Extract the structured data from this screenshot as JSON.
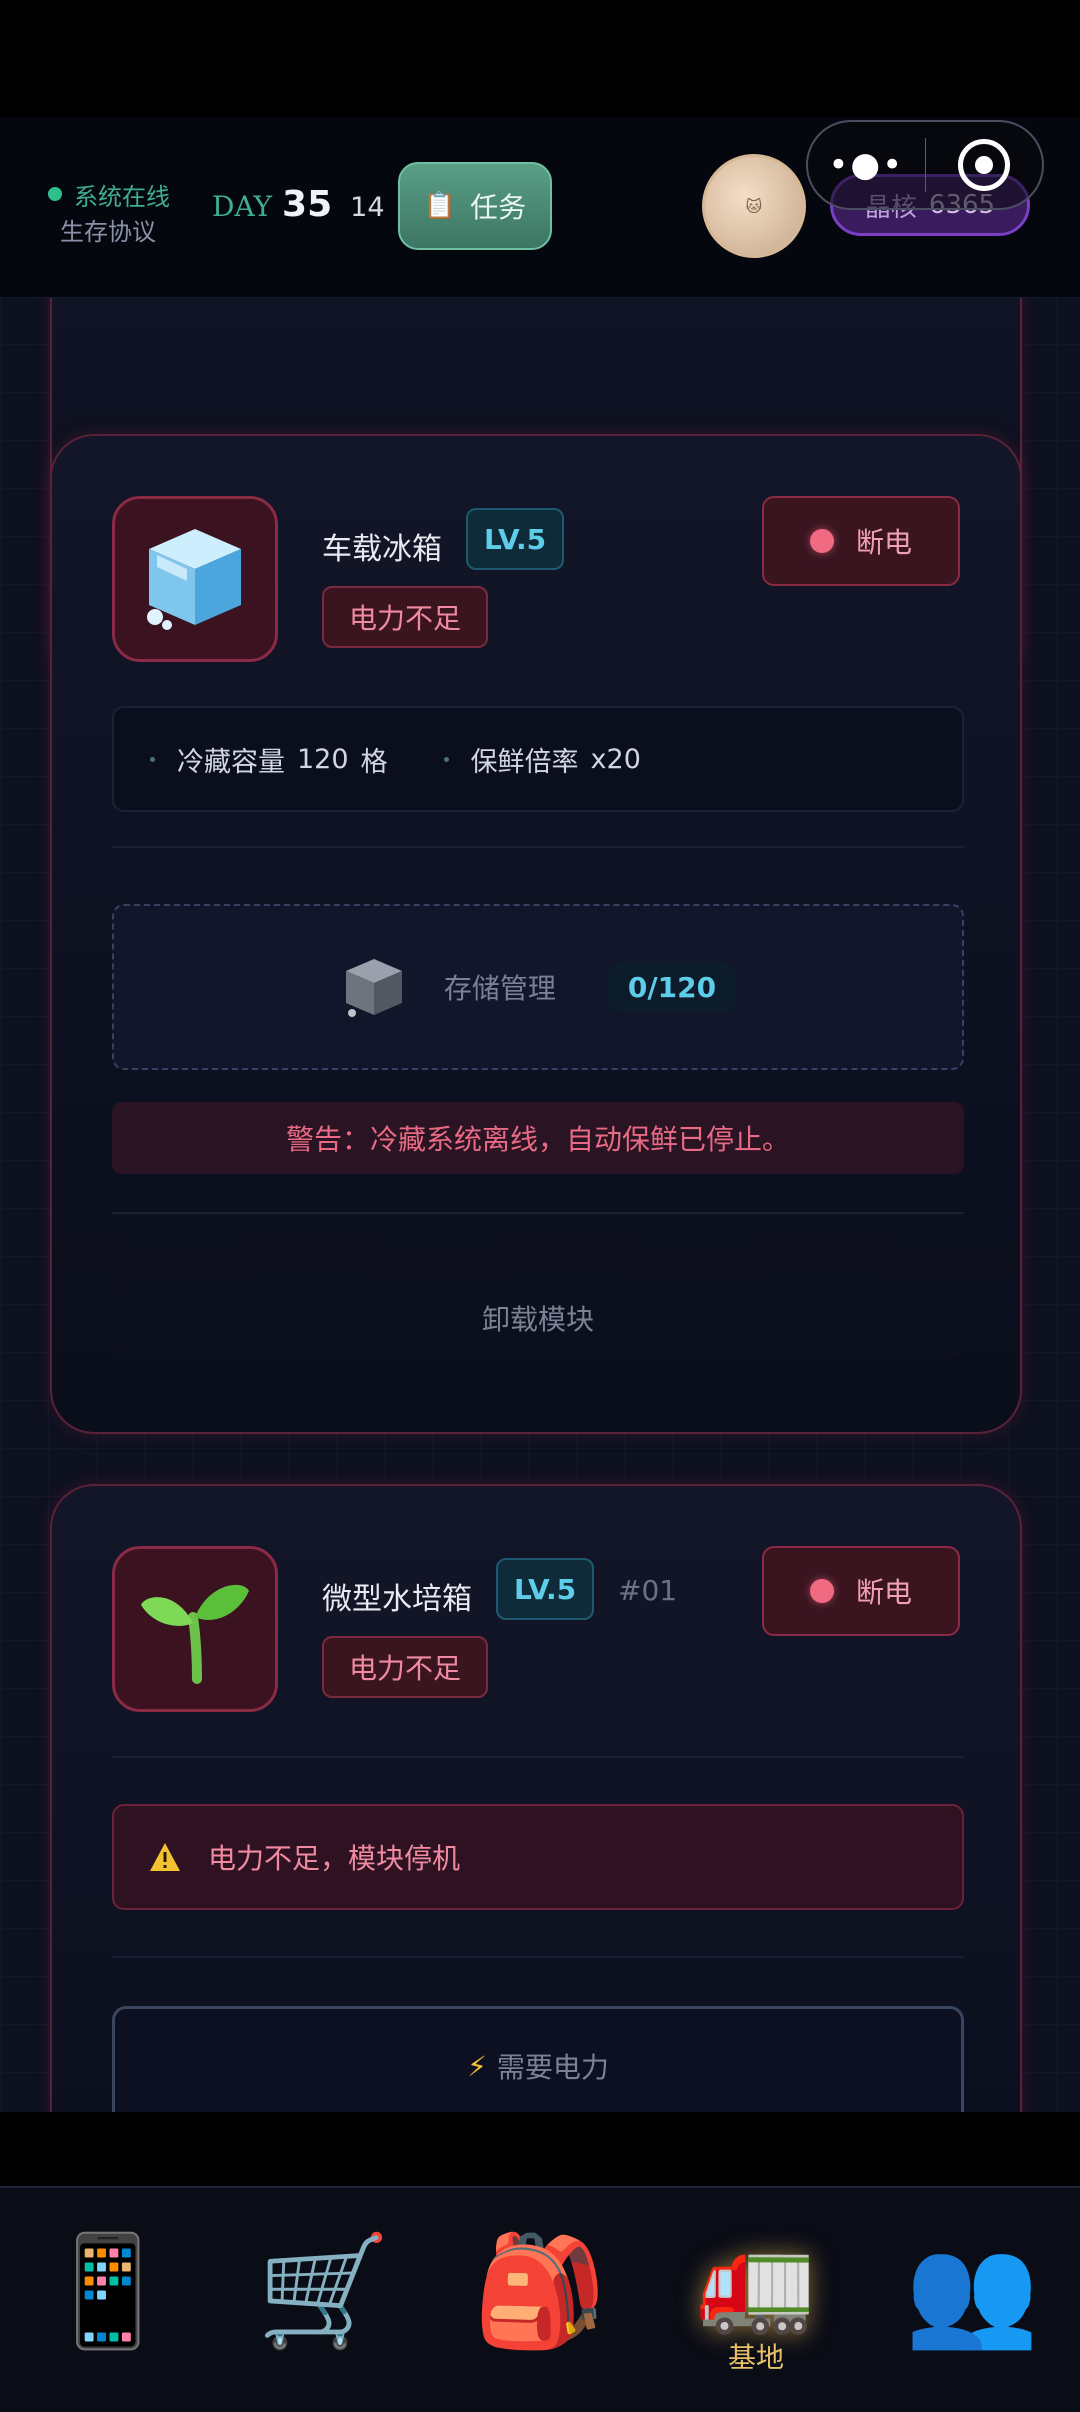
{
  "header": {
    "status_online": "系统在线",
    "status_protocol": "生存协议",
    "day_label": "DAY",
    "day_number": "35",
    "day_time": "14",
    "task_button": "任务",
    "avatar_text": "🐱",
    "crystal_label": "晶核",
    "crystal_value": "6365",
    "capsule_more": "•●•"
  },
  "modules": [
    {
      "name": "车载冰箱",
      "level": "LV.5",
      "warning_tag": "电力不足",
      "power_button": "断电",
      "stats": {
        "capacity_label": "冷藏容量",
        "capacity_value": "120",
        "capacity_unit": "格",
        "fresh_label": "保鲜倍率",
        "fresh_value": "x20"
      },
      "storage_label": "存储管理",
      "storage_count": "0/120",
      "alert": "警告：冷藏系统离线，自动保鲜已停止。",
      "unload_button": "卸载模块"
    },
    {
      "name": "微型水培箱",
      "level": "LV.5",
      "id": "#01",
      "warning_tag": "电力不足",
      "power_button": "断电",
      "stop_alert": "电力不足，模块停机",
      "need_power": "需要电力"
    }
  ],
  "nav": {
    "items": [
      {
        "icon": "phone-icon",
        "label": ""
      },
      {
        "icon": "cart-icon",
        "label": ""
      },
      {
        "icon": "backpack-icon",
        "label": ""
      },
      {
        "icon": "truck-icon",
        "label": "基地"
      },
      {
        "icon": "people-icon",
        "label": ""
      }
    ],
    "active_index": 3
  },
  "colors": {
    "accent_green": "#3fae8c",
    "accent_cyan": "#5ecdea",
    "danger_red": "#f06a82",
    "crystal_purple": "#7b3fc6",
    "nav_active": "#e6c068"
  }
}
